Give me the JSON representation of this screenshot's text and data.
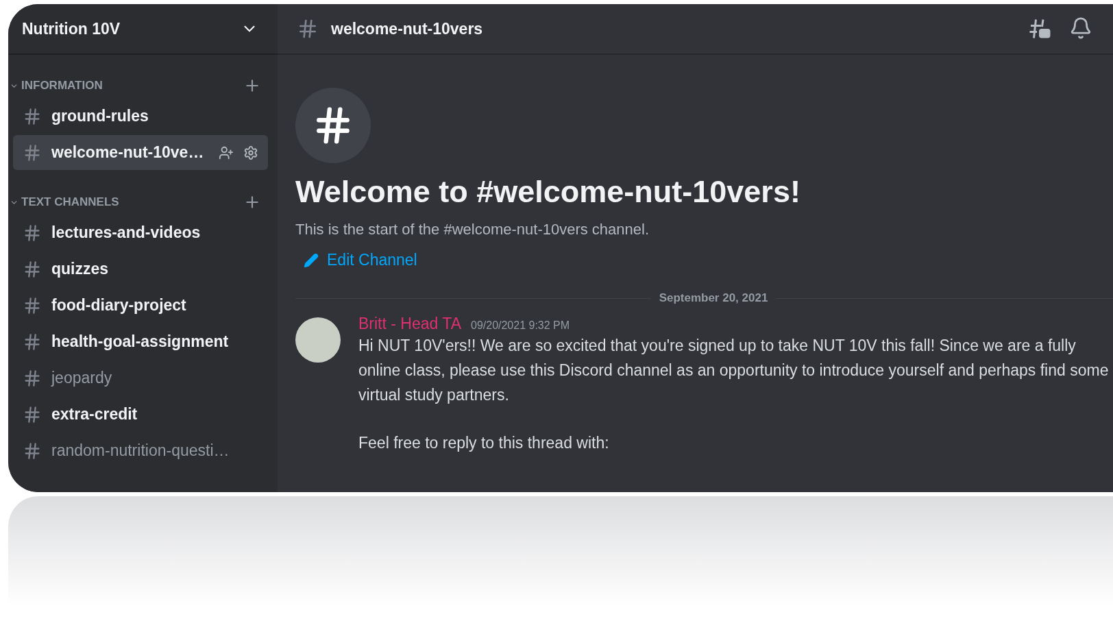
{
  "server": {
    "name": "Nutrition 10V"
  },
  "categories": [
    {
      "name": "INFORMATION",
      "expanded": true,
      "channels": [
        {
          "name": "ground-rules",
          "unread": true,
          "selected": false
        },
        {
          "name": "welcome-nut-10ve…",
          "unread": true,
          "selected": true
        }
      ]
    },
    {
      "name": "TEXT CHANNELS",
      "expanded": true,
      "channels": [
        {
          "name": "lectures-and-videos",
          "unread": true,
          "selected": false
        },
        {
          "name": "quizzes",
          "unread": true,
          "selected": false
        },
        {
          "name": "food-diary-project",
          "unread": true,
          "selected": false
        },
        {
          "name": "health-goal-assignment",
          "unread": true,
          "selected": false
        },
        {
          "name": "jeopardy",
          "unread": false,
          "selected": false
        },
        {
          "name": "extra-credit",
          "unread": true,
          "selected": false
        },
        {
          "name": "random-nutrition-questi…",
          "unread": false,
          "selected": false
        }
      ]
    }
  ],
  "header": {
    "channel": "welcome-nut-10vers"
  },
  "welcome": {
    "title": "Welcome to #welcome-nut-10vers!",
    "subtitle": "This is the start of the #welcome-nut-10vers channel.",
    "edit_link": "Edit Channel"
  },
  "divider_date": "September 20, 2021",
  "message": {
    "author": "Britt - Head TA",
    "timestamp": "09/20/2021 9:32 PM",
    "paragraphs": [
      "Hi NUT 10V'ers!! We are so excited that you're signed up to take NUT 10V this fall! Since we are a fully online class, please use this Discord channel as an opportunity to introduce yourself and perhaps find some virtual study partners.",
      "Feel free to reply to this thread with:"
    ]
  }
}
